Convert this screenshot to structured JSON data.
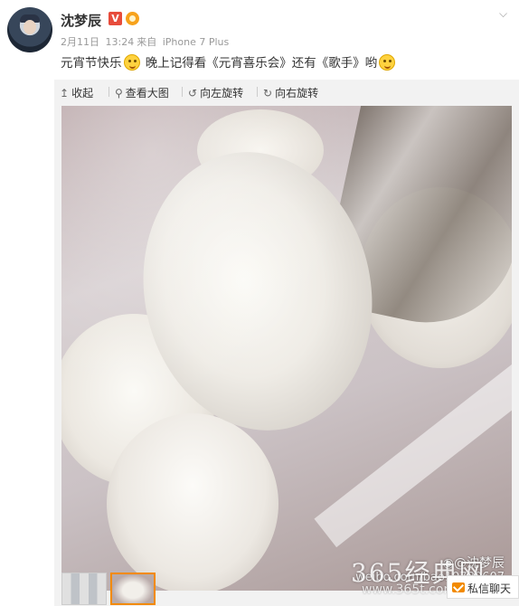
{
  "post": {
    "username": "沈梦辰",
    "verified_label": "V",
    "date": "2月11日",
    "time": "13:24",
    "source_prefix": "来自",
    "source": "iPhone 7 Plus",
    "text_part1": "元宵节快乐",
    "text_part2": "晚上记得看《元宵喜乐会》还有《歌手》哟",
    "emoji_1": "smile-emoji",
    "emoji_2": "tongue-emoji"
  },
  "media_toolbar": {
    "collapse": "收起",
    "view_large": "查看大图",
    "rotate_left": "向左旋转",
    "rotate_right": "向右旋转"
  },
  "photo": {
    "watermark_user": "沈梦辰",
    "watermark_url": "weibo.com/bao19780607"
  },
  "overlay": {
    "site_watermark": "365经典网",
    "site_url": "www.365t.com",
    "dm_button": "私信聊天"
  },
  "colors": {
    "accent": "#f28a00",
    "verified": "#e74c3c",
    "meta": "#999999"
  }
}
